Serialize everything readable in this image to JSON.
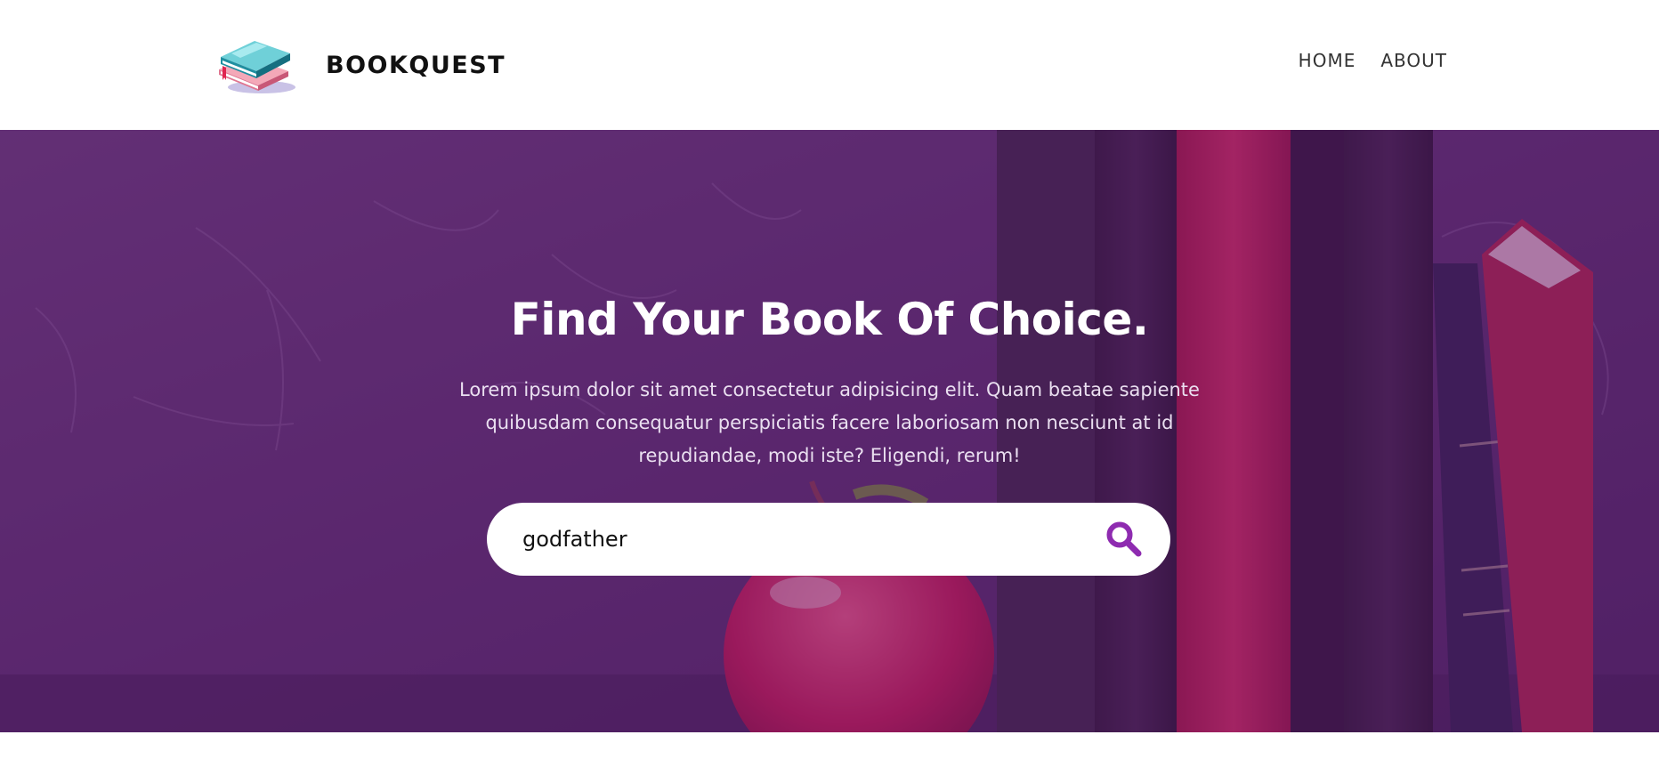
{
  "header": {
    "brand_name": "BOOKQUEST",
    "logo_icon": "book-icon",
    "nav": [
      {
        "label": "HOME"
      },
      {
        "label": "ABOUT"
      }
    ]
  },
  "hero": {
    "title": "Find Your Book Of Choice.",
    "description": "Lorem ipsum dolor sit amet consectetur adipisicing elit. Quam beatae sapiente quibusdam consequatur perspiciatis facere laboriosam non nesciunt at id repudiandae, modi iste? Eligendi, rerum!",
    "search": {
      "value": "godfather",
      "placeholder": "",
      "icon": "search-icon"
    }
  },
  "colors": {
    "accent": "#8e2bb0",
    "overlay": "#581e6c",
    "book_red": "#d12052"
  }
}
